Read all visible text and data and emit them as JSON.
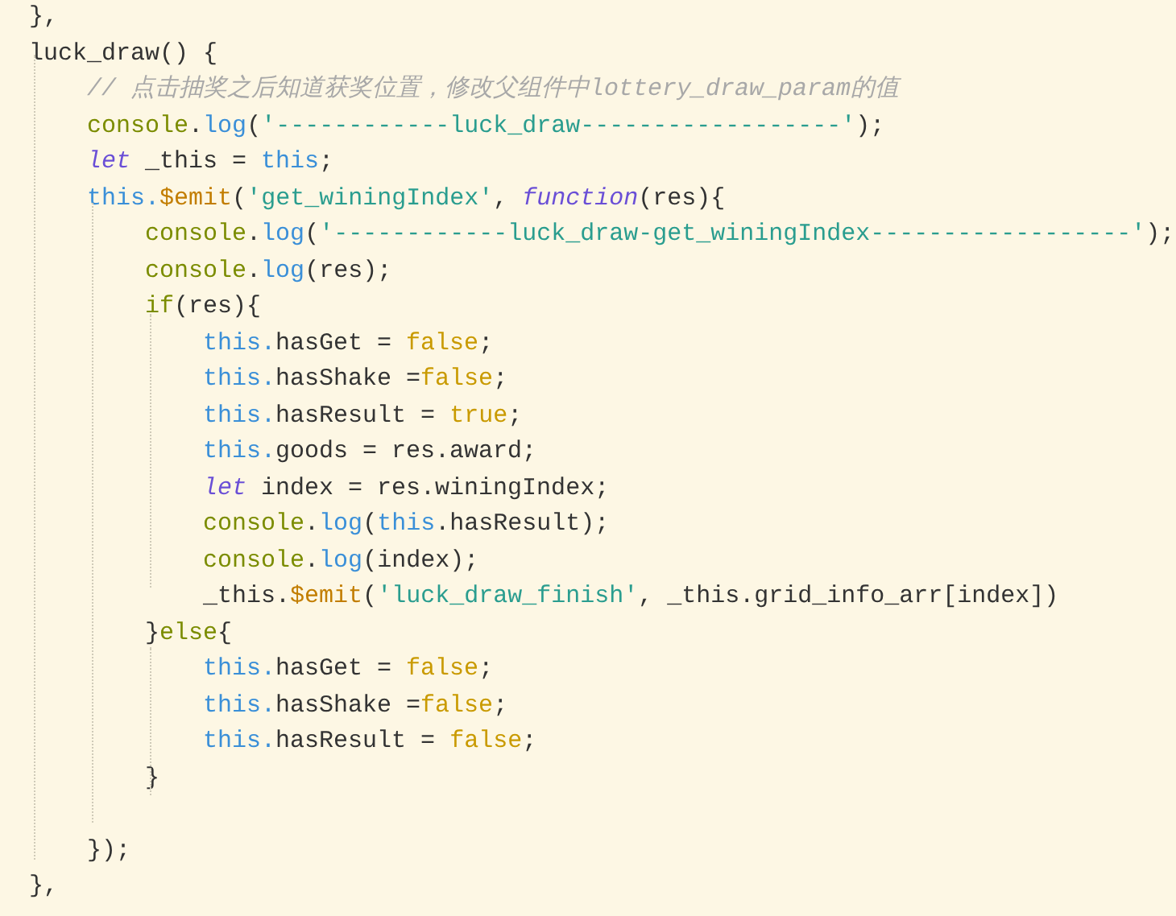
{
  "editor": {
    "lines": [
      [
        {
          "kind": "plain",
          "text": "  },"
        }
      ],
      [
        {
          "kind": "plain",
          "text": "  luck_draw() {"
        }
      ],
      [
        {
          "kind": "comment",
          "text": "      // 点击抽奖之后知道获奖位置，修改父组件中lottery_draw_param的值"
        }
      ],
      [
        {
          "kind": "console",
          "text": "      console"
        },
        {
          "kind": "plain",
          "text": "."
        },
        {
          "kind": "method",
          "text": "log"
        },
        {
          "kind": "plain",
          "text": "("
        },
        {
          "kind": "string",
          "text": "'------------luck_draw------------------'"
        },
        {
          "kind": "plain",
          "text": ");"
        }
      ],
      [
        {
          "kind": "keyword",
          "text": "      let"
        },
        {
          "kind": "plain",
          "text": " _this = "
        },
        {
          "kind": "this",
          "text": "this"
        },
        {
          "kind": "plain",
          "text": ";"
        }
      ],
      [
        {
          "kind": "this",
          "text": "      this."
        },
        {
          "kind": "emit",
          "text": "$emit"
        },
        {
          "kind": "plain",
          "text": "("
        },
        {
          "kind": "string",
          "text": "'get_winingIndex'"
        },
        {
          "kind": "plain",
          "text": ", "
        },
        {
          "kind": "keyword",
          "text": "function"
        },
        {
          "kind": "plain",
          "text": "(res){"
        }
      ],
      [
        {
          "kind": "console",
          "text": "          console"
        },
        {
          "kind": "plain",
          "text": "."
        },
        {
          "kind": "method",
          "text": "log"
        },
        {
          "kind": "plain",
          "text": "("
        },
        {
          "kind": "string",
          "text": "'------------luck_draw-get_winingIndex------------------'"
        },
        {
          "kind": "plain",
          "text": ");"
        }
      ],
      [
        {
          "kind": "console",
          "text": "          console"
        },
        {
          "kind": "plain",
          "text": "."
        },
        {
          "kind": "method",
          "text": "log"
        },
        {
          "kind": "plain",
          "text": "(res);"
        }
      ],
      [
        {
          "kind": "console",
          "text": "          if"
        },
        {
          "kind": "plain",
          "text": "(res){"
        }
      ],
      [
        {
          "kind": "this",
          "text": "              this."
        },
        {
          "kind": "plain",
          "text": "hasGet = "
        },
        {
          "kind": "literal",
          "text": "false"
        },
        {
          "kind": "plain",
          "text": ";"
        }
      ],
      [
        {
          "kind": "this",
          "text": "              this."
        },
        {
          "kind": "plain",
          "text": "hasShake ="
        },
        {
          "kind": "literal",
          "text": "false"
        },
        {
          "kind": "plain",
          "text": ";"
        }
      ],
      [
        {
          "kind": "this",
          "text": "              this."
        },
        {
          "kind": "plain",
          "text": "hasResult = "
        },
        {
          "kind": "literal",
          "text": "true"
        },
        {
          "kind": "plain",
          "text": ";"
        }
      ],
      [
        {
          "kind": "this",
          "text": "              this."
        },
        {
          "kind": "plain",
          "text": "goods = res.award;"
        }
      ],
      [
        {
          "kind": "keyword",
          "text": "              let"
        },
        {
          "kind": "plain",
          "text": " index = res.winingIndex;"
        }
      ],
      [
        {
          "kind": "console",
          "text": "              console"
        },
        {
          "kind": "plain",
          "text": "."
        },
        {
          "kind": "method",
          "text": "log"
        },
        {
          "kind": "plain",
          "text": "("
        },
        {
          "kind": "this",
          "text": "this"
        },
        {
          "kind": "plain",
          "text": ".hasResult);"
        }
      ],
      [
        {
          "kind": "console",
          "text": "              console"
        },
        {
          "kind": "plain",
          "text": "."
        },
        {
          "kind": "method",
          "text": "log"
        },
        {
          "kind": "plain",
          "text": "(index);"
        }
      ],
      [
        {
          "kind": "plain",
          "text": "              _this."
        },
        {
          "kind": "emit",
          "text": "$emit"
        },
        {
          "kind": "plain",
          "text": "("
        },
        {
          "kind": "string",
          "text": "'luck_draw_finish'"
        },
        {
          "kind": "plain",
          "text": ", _this.grid_info_arr[index])"
        }
      ],
      [
        {
          "kind": "plain",
          "text": "          }"
        },
        {
          "kind": "console",
          "text": "else"
        },
        {
          "kind": "plain",
          "text": "{"
        }
      ],
      [
        {
          "kind": "this",
          "text": "              this."
        },
        {
          "kind": "plain",
          "text": "hasGet = "
        },
        {
          "kind": "literal",
          "text": "false"
        },
        {
          "kind": "plain",
          "text": ";"
        }
      ],
      [
        {
          "kind": "this",
          "text": "              this."
        },
        {
          "kind": "plain",
          "text": "hasShake ="
        },
        {
          "kind": "literal",
          "text": "false"
        },
        {
          "kind": "plain",
          "text": ";"
        }
      ],
      [
        {
          "kind": "this",
          "text": "              this."
        },
        {
          "kind": "plain",
          "text": "hasResult = "
        },
        {
          "kind": "literal",
          "text": "false"
        },
        {
          "kind": "plain",
          "text": ";"
        }
      ],
      [
        {
          "kind": "plain",
          "text": "          }"
        }
      ],
      {
        "spaced_above": true,
        "tokens": [
          {
            "kind": "plain",
            "text": "      });"
          }
        ]
      },
      [
        {
          "kind": "plain",
          "text": "  },"
        }
      ]
    ]
  }
}
